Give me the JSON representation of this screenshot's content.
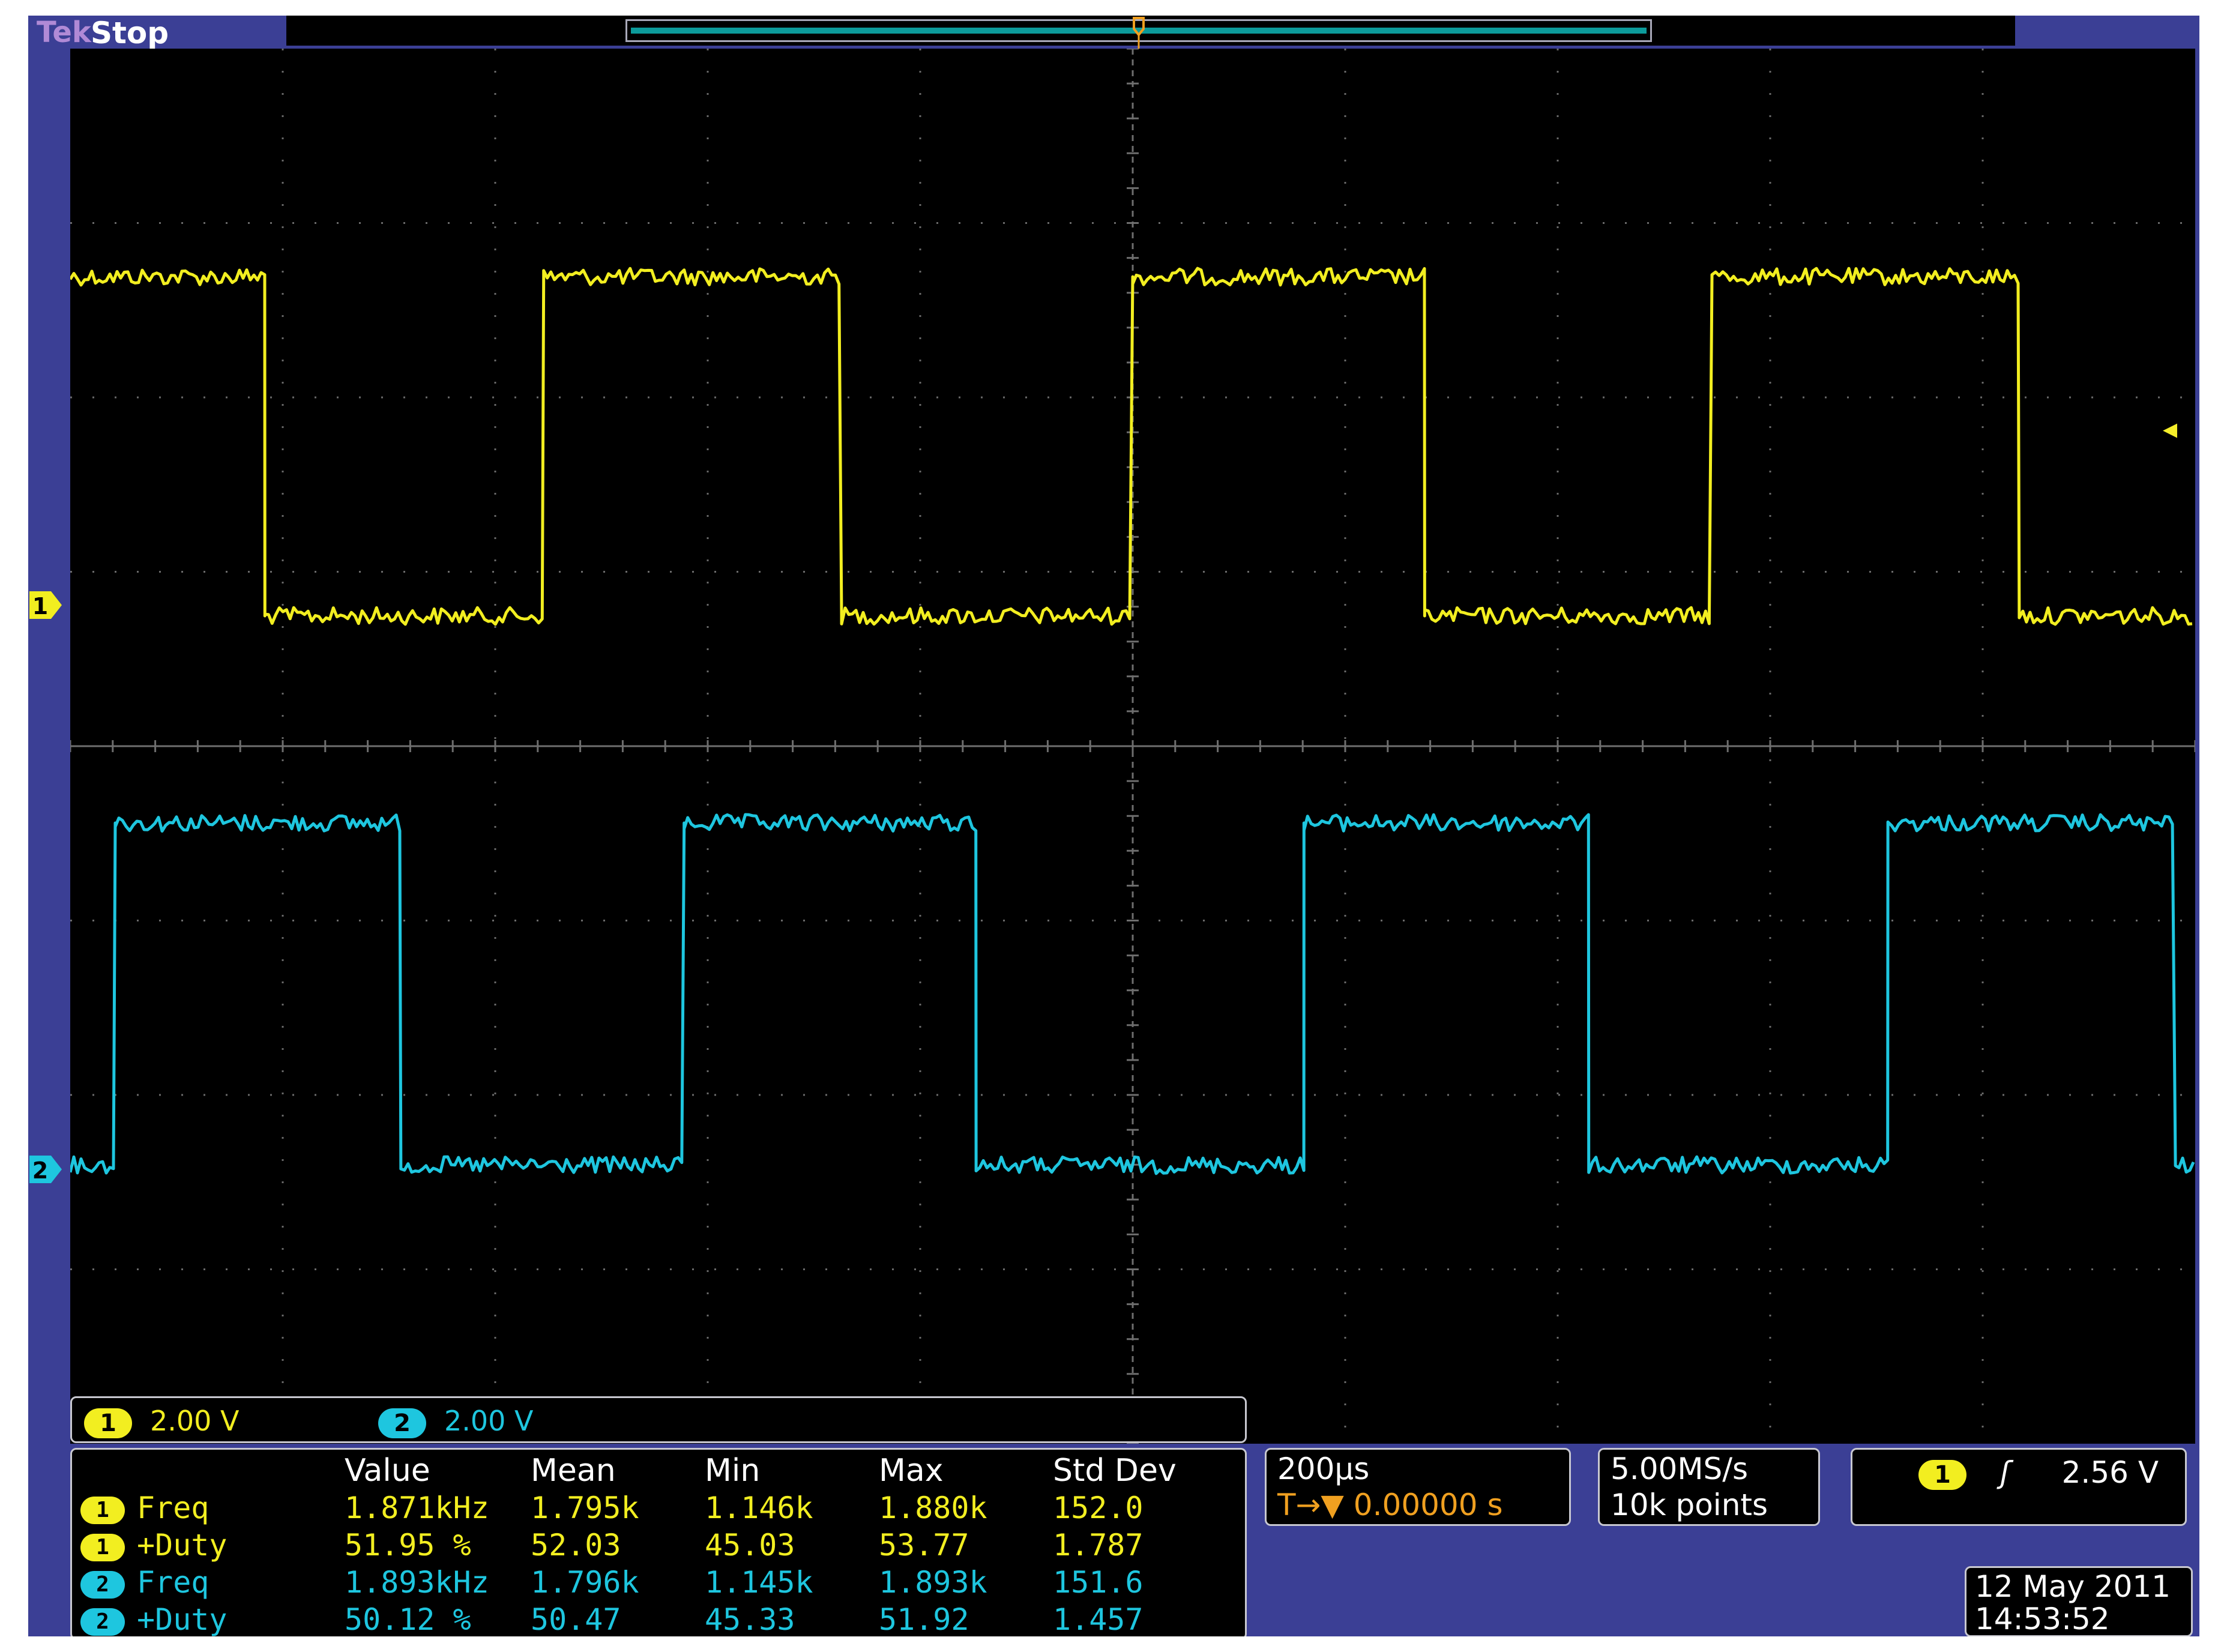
{
  "status": {
    "brand": "Tek",
    "state": "Stop"
  },
  "colors": {
    "ch1": "#f2ee20",
    "ch2": "#1ec6df",
    "trigger": "#f0a020",
    "frame": "#3b3f95",
    "screen": "#000000"
  },
  "trigger_marker": {
    "letter": "T"
  },
  "channels": [
    {
      "number": "1",
      "scale": "2.00 V"
    },
    {
      "number": "2",
      "scale": "2.00 V"
    }
  ],
  "measurements": {
    "headers": [
      "Value",
      "Mean",
      "Min",
      "Max",
      "Std Dev"
    ],
    "rows": [
      {
        "channel": "1",
        "name": "Freq",
        "value": "1.871kHz",
        "mean": "1.795k",
        "min": "1.146k",
        "max": "1.880k",
        "std": "152.0"
      },
      {
        "channel": "1",
        "name": "+Duty",
        "value": "51.95 %",
        "mean": "52.03",
        "min": "45.03",
        "max": "53.77",
        "std": "1.787"
      },
      {
        "channel": "2",
        "name": "Freq",
        "value": "1.893kHz",
        "mean": "1.796k",
        "min": "1.145k",
        "max": "1.893k",
        "std": "151.6"
      },
      {
        "channel": "2",
        "name": "+Duty",
        "value": "50.12 %",
        "mean": "50.47",
        "min": "45.33",
        "max": "51.92",
        "std": "1.457"
      }
    ]
  },
  "timebase": {
    "scale": "200µs",
    "position_icon": "T→▼",
    "position": "0.00000 s"
  },
  "acquisition": {
    "sample_rate": "5.00MS/s",
    "record_length": "10k points"
  },
  "trigger": {
    "source": "1",
    "slope_icon": "rising-edge",
    "slope_glyph": "ʃ",
    "level": "2.56 V"
  },
  "datetime": {
    "date": "12 May 2011",
    "time": "14:53:52"
  },
  "waveforms": {
    "ch1_edges_div": [
      0,
      0.916,
      2.228,
      3.63,
      5.0,
      6.374,
      7.726,
      9.172,
      10
    ],
    "ch1_starts_high": true,
    "ch2_edges_div": [
      0,
      0.212,
      1.556,
      2.889,
      4.263,
      5.806,
      7.146,
      8.554,
      9.907,
      10
    ],
    "ch2_starts_high": false
  }
}
